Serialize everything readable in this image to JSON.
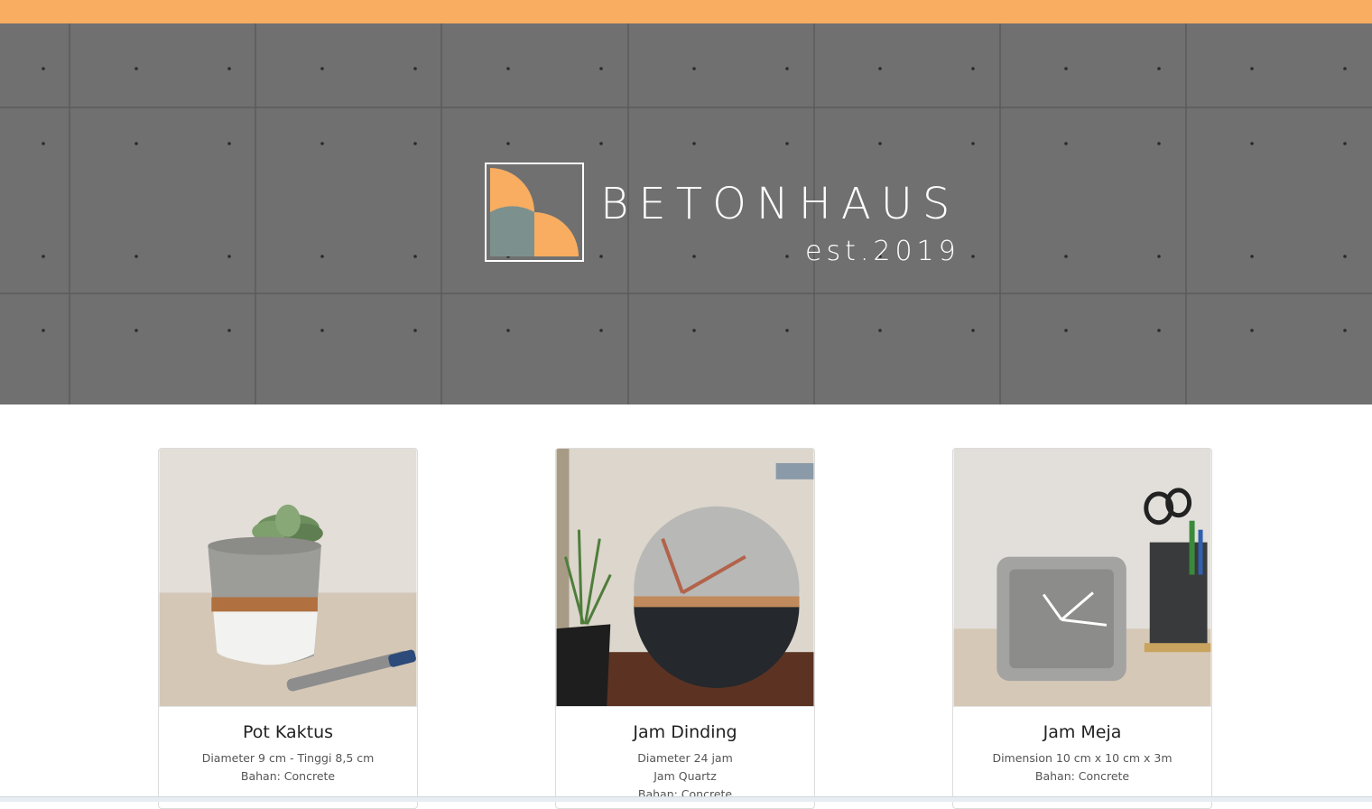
{
  "brand": {
    "name": "BETONHAUS",
    "established": "est.2019",
    "accent_color": "#f8ad61",
    "secondary_color": "#7c918e"
  },
  "products": [
    {
      "title": "Pot Kaktus",
      "details": [
        "Diameter 9 cm - Tinggi 8,5 cm",
        "Bahan: Concrete"
      ],
      "image": "concrete-cactus-pot-photo"
    },
    {
      "title": "Jam Dinding",
      "details": [
        "Diameter 24 jam",
        "Jam Quartz",
        "Bahan: Concrete"
      ],
      "image": "concrete-wall-clock-photo"
    },
    {
      "title": "Jam Meja",
      "details": [
        "Dimension 10 cm x 10 cm x 3m",
        "Bahan: Concrete"
      ],
      "image": "concrete-desk-clock-photo"
    }
  ]
}
